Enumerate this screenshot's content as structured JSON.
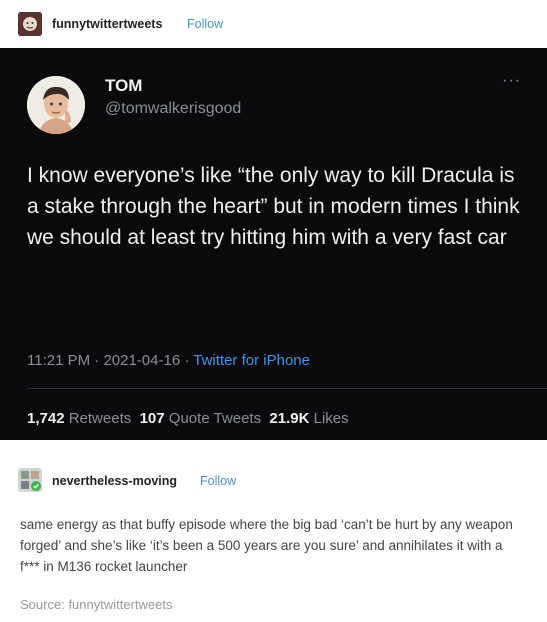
{
  "post": {
    "username": "funnytwittertweets",
    "follow_label": "Follow"
  },
  "tweet": {
    "name": "TOM",
    "handle": "@tomwalkerisgood",
    "more": "···",
    "body": "I know everyone’s like “the only way to kill Dracula is a stake through the heart” but in modern times I think we should at least try hitting him with a very fast car",
    "time": "11:21 PM",
    "date": "2021-04-16",
    "sep": "·",
    "client": "Twitter for iPhone",
    "retweets_count": "1,742",
    "retweets_label": "Retweets",
    "quotes_count": "107",
    "quotes_label": "Quote Tweets",
    "likes_count": "21.9K",
    "likes_label": "Likes"
  },
  "reblog": {
    "username": "nevertheless-moving",
    "follow_label": "Follow",
    "text": "same energy as that buffy episode where the big bad ‘can’t be hurt by any weapon forged’ and she’s like ‘it’s been a 500 years are you sure’ and annihilates it with a f*** in M136 rocket launcher"
  },
  "source": {
    "label": "Source:",
    "name": "funnytwittertweets"
  },
  "colors": {
    "follow": "#4a90c8",
    "tweet_bg": "#0a0a0c",
    "twitter_link": "#3a97e6"
  }
}
